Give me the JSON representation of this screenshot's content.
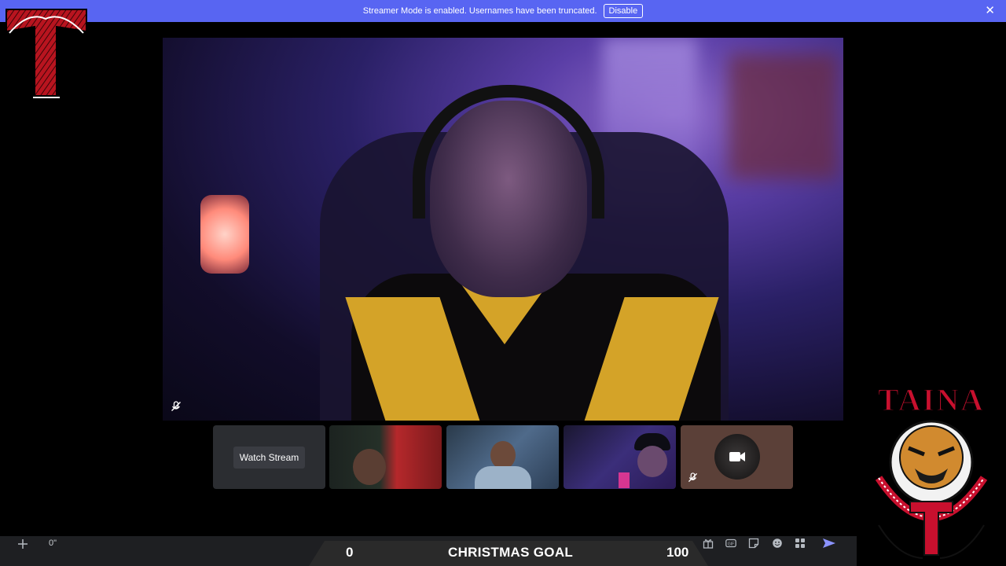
{
  "banner": {
    "message": "Streamer Mode is enabled. Usernames have been truncated.",
    "disable_label": "Disable",
    "close_icon": "close-icon"
  },
  "branding": {
    "top_left_logo": "letter-t-logo",
    "bottom_right_logo": "taina-logo",
    "bottom_right_logo_text": "TAINA",
    "bottom_right_logo_motto": "humble loyal ruthless"
  },
  "call": {
    "main_video_muted_icon": "mic-muted-icon",
    "tiles": [
      {
        "kind": "stream",
        "label": "Watch Stream"
      },
      {
        "kind": "participant"
      },
      {
        "kind": "participant"
      },
      {
        "kind": "participant"
      },
      {
        "kind": "participant",
        "avatar_icon": "camera-icon",
        "muted_icon": "mic-muted-icon"
      }
    ]
  },
  "composer": {
    "text": "0\""
  },
  "goal": {
    "current": "0",
    "title": "CHRISTMAS GOAL",
    "target": "100"
  },
  "toolbar": {
    "icons": [
      "gift-icon",
      "gif-icon",
      "sticker-icon",
      "emoji-icon",
      "apps-icon",
      "send-icon"
    ]
  },
  "colors": {
    "banner": "#5865f2",
    "background": "#000000",
    "bar": "#1e1f22",
    "tile": "#2b2d31",
    "logo_red": "#c8102e"
  }
}
